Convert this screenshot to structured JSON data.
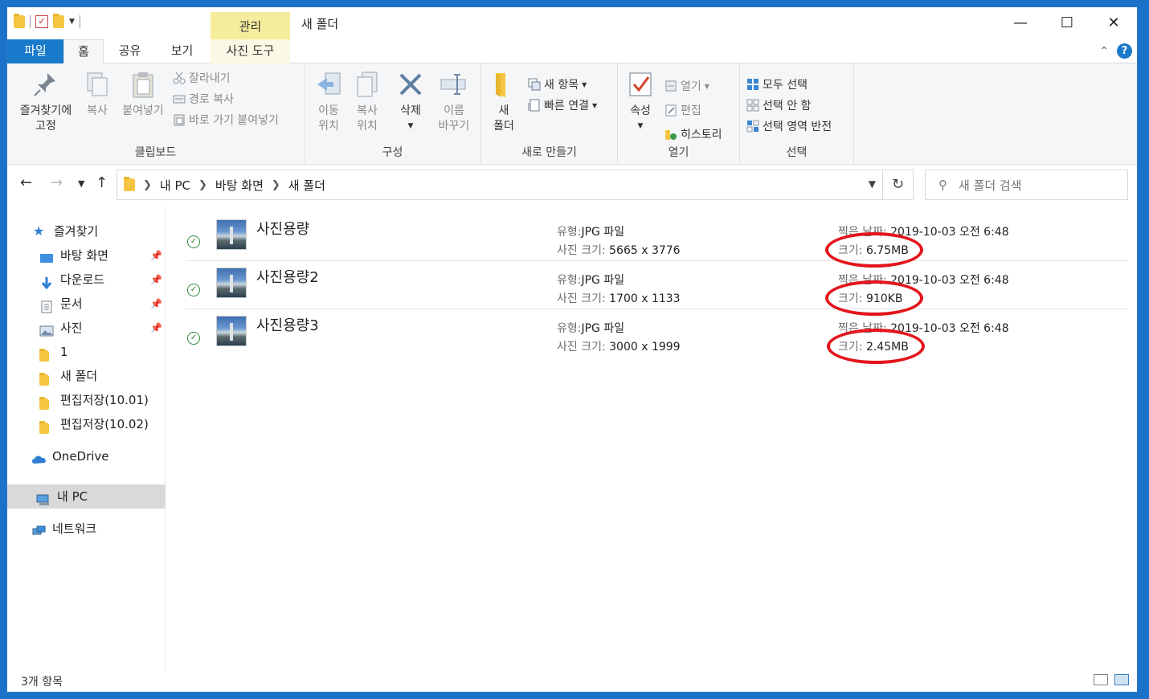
{
  "window": {
    "title": "새 폴더",
    "context_tab": "관리",
    "controls": [
      "—",
      "☐",
      "✕"
    ]
  },
  "ribbon_tabs": [
    "파일",
    "홈",
    "공유",
    "보기",
    "사진 도구"
  ],
  "ribbon": {
    "clipboard": {
      "label": "클립보드",
      "pin_label_1": "즐겨찾기에",
      "pin_label_2": "고정",
      "copy": "복사",
      "paste": "붙여넣기",
      "cut": "잘라내기",
      "copy_path": "경로 복사",
      "paste_shortcut": "바로 가기 붙여넣기"
    },
    "organize": {
      "label": "구성",
      "move_1": "이동",
      "move_2": "위치",
      "copyto_1": "복사",
      "copyto_2": "위치",
      "delete": "삭제",
      "rename_1": "이름",
      "rename_2": "바꾸기"
    },
    "new": {
      "label": "새로 만들기",
      "folder_1": "새",
      "folder_2": "폴더",
      "new_item": "새 항목",
      "easy_access": "빠른 연결"
    },
    "open": {
      "label": "열기",
      "properties": "속성",
      "open": "열기",
      "edit": "편집",
      "history": "히스토리"
    },
    "select": {
      "label": "선택",
      "select_all": "모두 선택",
      "select_none": "선택 안 함",
      "invert": "선택 영역 반전"
    }
  },
  "address": {
    "crumbs": [
      "내 PC",
      "바탕 화면",
      "새 폴더"
    ],
    "search_placeholder": "새 폴더 검색"
  },
  "sidebar": {
    "items": [
      {
        "label": "즐겨찾기",
        "icon": "star-icon"
      },
      {
        "label": "바탕 화면",
        "icon": "desktop-icon",
        "pinned": true
      },
      {
        "label": "다운로드",
        "icon": "download-icon",
        "pinned": true
      },
      {
        "label": "문서",
        "icon": "document-icon",
        "pinned": true
      },
      {
        "label": "사진",
        "icon": "pictures-icon",
        "pinned": true
      },
      {
        "label": "1",
        "icon": "folder-icon"
      },
      {
        "label": "새 폴더",
        "icon": "folder-icon"
      },
      {
        "label": "편집저장(10.01)",
        "icon": "folder-icon"
      },
      {
        "label": "편집저장(10.02)",
        "icon": "folder-icon"
      },
      {
        "label": "OneDrive",
        "icon": "cloud-icon"
      },
      {
        "label": "내 PC",
        "icon": "pc-icon"
      },
      {
        "label": "네트워크",
        "icon": "network-icon"
      }
    ]
  },
  "labels": {
    "type": "유형:",
    "dimensions": "사진 크기:",
    "date_taken": "찍은 날짜:",
    "size": "크기:"
  },
  "files": [
    {
      "name": "사진용량",
      "type": "JPG 파일",
      "dimensions": "5665 x 3776",
      "date": "2019-10-03 오전 6:48",
      "size": "6.75MB"
    },
    {
      "name": "사진용량2",
      "type": "JPG 파일",
      "dimensions": "1700 x 1133",
      "date": "2019-10-03 오전 6:48",
      "size": "910KB"
    },
    {
      "name": "사진용량3",
      "type": "JPG 파일",
      "dimensions": "3000 x 1999",
      "date": "2019-10-03 오전 6:48",
      "size": "2.45MB"
    }
  ],
  "status": {
    "count": "3개 항목"
  },
  "colors": {
    "accent": "#1979ca",
    "annotation_ring": "#e3151c",
    "context_tab": "#f5ec9c"
  }
}
